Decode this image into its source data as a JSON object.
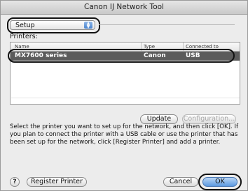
{
  "window": {
    "title": "Canon IJ Network Tool"
  },
  "mode_select": {
    "selected": "Setup"
  },
  "printers": {
    "label": "Printers:",
    "columns": [
      "Name",
      "Type",
      "Connected to"
    ],
    "rows": [
      {
        "name": "MX7600 series",
        "type": "Canon",
        "connected_to": "USB",
        "selected": true
      }
    ]
  },
  "buttons": {
    "update": "Update",
    "configuration": "Configuration...",
    "register_printer": "Register Printer",
    "cancel": "Cancel",
    "ok": "OK"
  },
  "description": "Select the printer you want to set up for the network, and then click [OK]. If you plan to connect the printer with a USB cable or use the printer that has been set up for the network, click [Register Printer] and add a printer.",
  "help": {
    "glyph": "?"
  },
  "icons": {
    "popup_arrows": "up-down-arrows-icon",
    "help": "help-icon"
  }
}
